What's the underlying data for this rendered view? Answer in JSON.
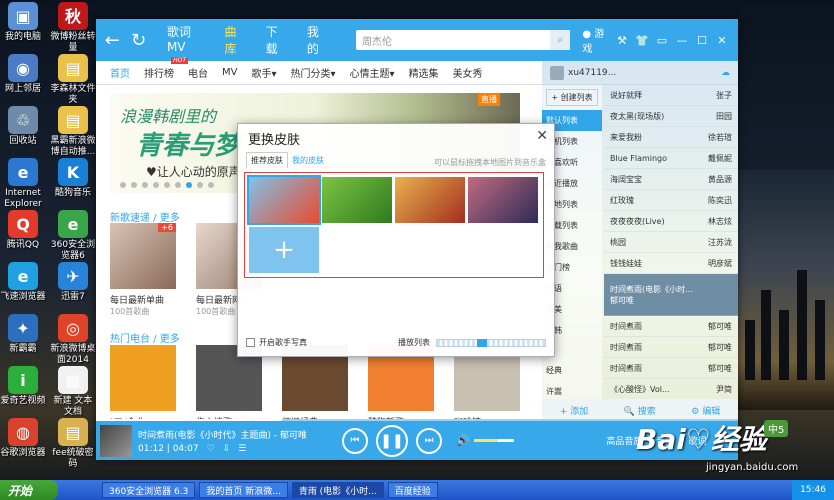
{
  "desktop": {
    "icons": [
      {
        "label": "我的电脑",
        "glyph": "▣",
        "color": "#5b8fd6"
      },
      {
        "label": "网上邻居",
        "glyph": "◉",
        "color": "#4b7bc4"
      },
      {
        "label": "回收站",
        "glyph": "♲",
        "color": "#6e8aa8"
      },
      {
        "label": "Internet Explorer",
        "glyph": "e",
        "color": "#2b78d0"
      },
      {
        "label": "腾讯QQ",
        "glyph": "Q",
        "color": "#e43a2a"
      },
      {
        "label": "飞速浏览器",
        "glyph": "e",
        "color": "#1fa0e0"
      },
      {
        "label": "新霸霸",
        "glyph": "✦",
        "color": "#2d6fbf"
      },
      {
        "label": "爱奇艺视频",
        "glyph": "i",
        "color": "#2cae3a"
      },
      {
        "label": "谷歌浏览器",
        "glyph": "◍",
        "color": "#d9432e"
      },
      {
        "label": "微博粉丝转量",
        "glyph": "秋",
        "color": "#c01818"
      },
      {
        "label": "李森林文件夹",
        "glyph": "▤",
        "color": "#e9c14b"
      },
      {
        "label": "黑霸新浪微博自动推...",
        "glyph": "▤",
        "color": "#e9c14b"
      },
      {
        "label": "酷狗音乐",
        "glyph": "K",
        "color": "#1a7fd6"
      },
      {
        "label": "360安全浏览器6",
        "glyph": "e",
        "color": "#3aa64a"
      },
      {
        "label": "迅雷7",
        "glyph": "✈",
        "color": "#2784d8"
      },
      {
        "label": "新浪微博桌面2014",
        "glyph": "◎",
        "color": "#e0432a"
      },
      {
        "label": "新建 文本文档",
        "glyph": "▦",
        "color": "#f1f1f1"
      },
      {
        "label": "fee统破密码",
        "glyph": "▤",
        "color": "#d8b250"
      }
    ]
  },
  "taskbar": {
    "start_label": "开始",
    "items": [
      "360安全浏览器 6.3",
      "我的首页 新浪微...",
      "青雨 (电影《小时...",
      "百度经验"
    ],
    "clock": "15:46"
  },
  "player": {
    "topbar": {
      "tabs": [
        "歌词MV",
        "曲库",
        "下载",
        "我的"
      ],
      "active_tab": "曲库",
      "search_placeholder": "周杰伦",
      "games_label": "游戏",
      "win_controls": [
        "⚒",
        "👕",
        "▭",
        "—",
        "☐",
        "✕"
      ]
    },
    "subnav": {
      "tabs": [
        "首页",
        "排行榜",
        "电台",
        "MV",
        "歌手▾",
        "热门分类▾",
        "心情主题▾",
        "精选集",
        "美女秀"
      ],
      "hot_badge": "HOT"
    },
    "banner": {
      "line1": "浪漫韩剧里的",
      "line2": "青春与梦",
      "line3": "♥让人心动的原声歌",
      "tag": "直播"
    },
    "sections": {
      "new_songs": "新歌速递 / 更多",
      "hot_radio": "热门电台 / 更多"
    },
    "new_cards": [
      {
        "caption": "每日最新单曲",
        "sub": "100首歌曲",
        "badge": "+6"
      },
      {
        "caption": "每日最新网...",
        "sub": "100首歌曲",
        "badge": ""
      }
    ],
    "radio_cards": [
      {
        "caption": "KTV金曲"
      },
      {
        "caption": "伤心情歌"
      },
      {
        "caption": "怀旧经典"
      },
      {
        "caption": "酷狗新歌"
      },
      {
        "caption": "咖啡馆"
      }
    ],
    "right_panel": {
      "user": "xu47119...",
      "side_items": [
        "+ 创建列表",
        "默认列表",
        "手机列表",
        "我喜欢听",
        "最近播放",
        "本地列表",
        "下载列表",
        "有我歌曲",
        "热门榜",
        "华语",
        "欧美",
        "日韩",
        "DJ",
        "经典",
        "许嵩"
      ],
      "songs": [
        {
          "title": "说好就拜",
          "artist": "张子"
        },
        {
          "title": "夜太黑(现场版)",
          "artist": "田园"
        },
        {
          "title": "来爱我粉",
          "artist": "徐若瑄"
        },
        {
          "title": "Blue Flamingo",
          "artist": "戴佩妮"
        },
        {
          "title": "海阔宝宝",
          "artist": "黄品源"
        },
        {
          "title": "红玫瑰",
          "artist": "陈奕迅"
        },
        {
          "title": "夜夜夜夜(Live)",
          "artist": "林志炫"
        },
        {
          "title": "桃园",
          "artist": "汪苏泷"
        },
        {
          "title": "钱钱娃娃",
          "artist": "明彦斌"
        }
      ],
      "playing": {
        "title": "时间煮雨(电影《小时...",
        "artist": "郁可唯"
      },
      "songs_after": [
        {
          "title": "时间煮雨",
          "artist": "郁可唯"
        },
        {
          "title": "时间煮雨",
          "artist": "郁可唯"
        },
        {
          "title": "时间煮雨",
          "artist": "郁可唯"
        },
        {
          "title": "《心酸怪》Vol...",
          "artist": "尹简"
        },
        {
          "title": "时间煮雨",
          "artist": "郁可唯"
        },
        {
          "title": "时间煮雨(电影《小时...",
          "artist": "郁可唯"
        }
      ],
      "bottom": [
        "+ 添加",
        "🔍 搜索",
        "⚙ 编辑"
      ]
    },
    "playbar": {
      "title": "时间煮雨(电影《小时代》主题曲) - 郁可唯",
      "time": "01:12 | 04:07",
      "right_labels": [
        "高品音质",
        "音效",
        "歌词",
        "≡"
      ],
      "progress": 0.29,
      "volume": 0.6
    }
  },
  "dialog": {
    "title": "更换皮肤",
    "tabs": [
      "推荐皮肤",
      "我的皮肤"
    ],
    "hint": "可以鼠标拖拽本地图片到音乐盒",
    "skins": [
      {
        "name": "train-skin",
        "colors": [
          "#7ec3e8",
          "#e84a2f"
        ]
      },
      {
        "name": "drop-skin",
        "colors": [
          "#7cc443",
          "#2e7a1e"
        ]
      },
      {
        "name": "bottle-skin",
        "colors": [
          "#e7b24e",
          "#a42d20"
        ]
      },
      {
        "name": "dance-skin",
        "colors": [
          "#c06b7f",
          "#2d2a58"
        ]
      }
    ],
    "checkbox_label": "开启歌手写真",
    "slider_label": "播放列表",
    "slider_value": 0.4
  },
  "watermark": {
    "text": "Bai♡经验",
    "url": "jingyan.baidu.com",
    "ime": "中5"
  }
}
